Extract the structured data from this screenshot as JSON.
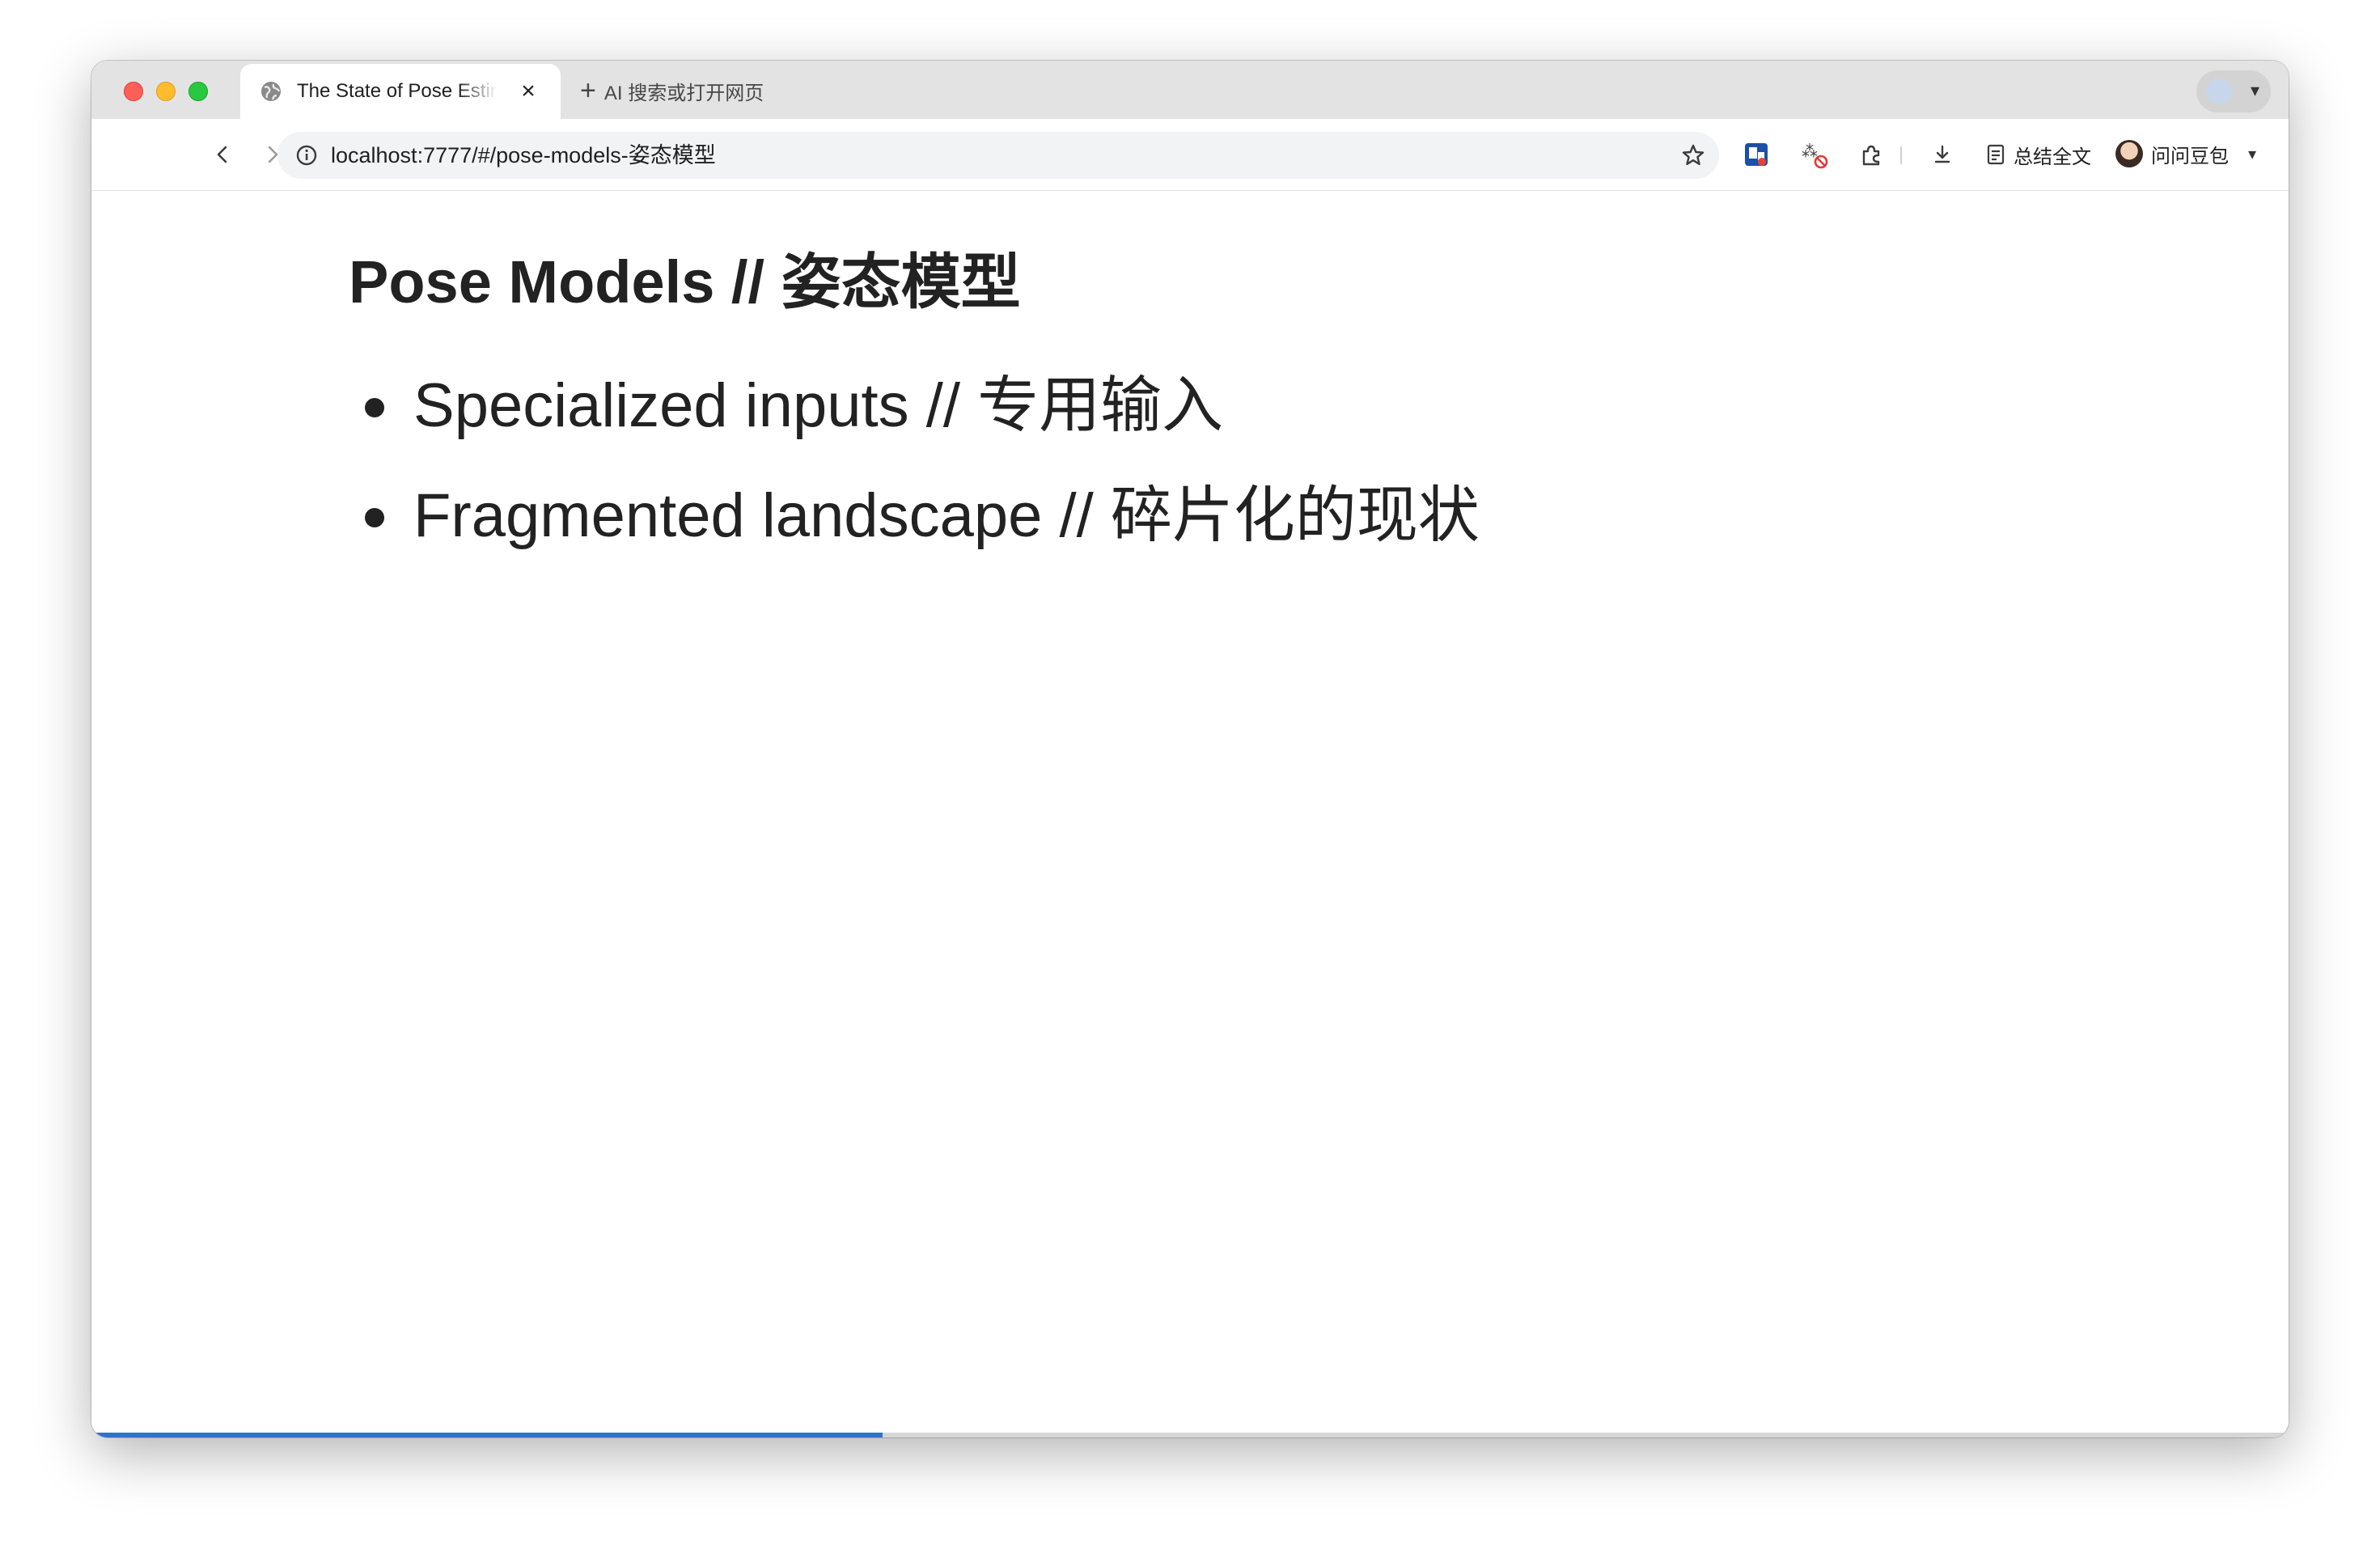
{
  "browser": {
    "tab": {
      "title": "The State of Pose Estimation"
    },
    "new_tab_label": "AI 搜索或打开网页",
    "url": "localhost:7777/#/pose-models-姿态模型",
    "toolbar": {
      "summary_label": "总结全文",
      "doubao_label": "问问豆包"
    }
  },
  "slide": {
    "title": "Pose Models // 姿态模型",
    "bullets": [
      "Specialized inputs // 专用输入",
      "Fragmented landscape // 碎片化的现状"
    ],
    "progress_fraction": 0.36
  },
  "colors": {
    "accent": "#2f74c9",
    "text": "#222222",
    "tabstrip": "#e3e3e3"
  }
}
